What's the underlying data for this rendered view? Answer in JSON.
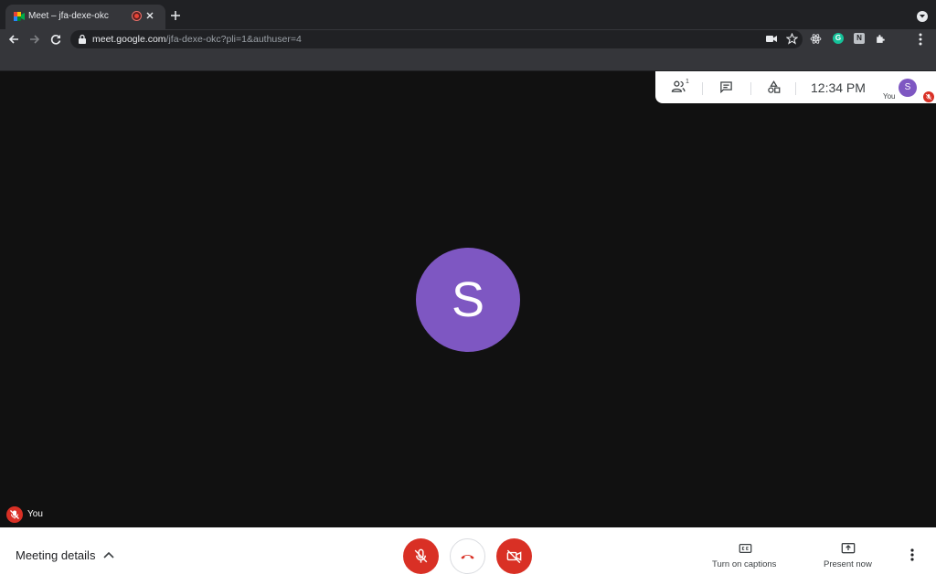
{
  "browser": {
    "tab": {
      "title": "Meet – jfa-dexe-okc",
      "favicon": "google-meet-icon",
      "recording_indicator": "recording-icon"
    },
    "omnibox": {
      "host": "meet.google.com",
      "path": "/jfa-dexe-okc?pli=1&authuser=4"
    },
    "extensions": [
      "react-devtools-icon",
      "grammarly-icon",
      "notion-icon",
      "puzzle-icon"
    ],
    "extension_letters": {
      "grammarly": "G",
      "notion": "N"
    }
  },
  "meet": {
    "participant_initial": "S",
    "participant_color": "#7e57c2",
    "name_tag": "You",
    "info_panel": {
      "people_count": "1",
      "clock": "12:34  PM",
      "self_label": "You",
      "self_initial": "S"
    },
    "bottom_bar": {
      "meeting_details": "Meeting details",
      "captions_label": "Turn on captions",
      "present_label": "Present now",
      "mic_state": "muted",
      "camera_state": "off"
    },
    "colors": {
      "danger": "#d93025",
      "background": "#111111",
      "hangup_icon": "#d93025"
    }
  }
}
